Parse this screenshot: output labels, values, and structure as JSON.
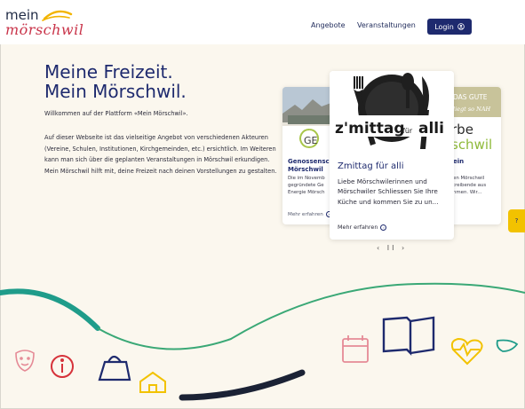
{
  "header": {
    "logo_top": "mein",
    "logo_name": "mörschwil",
    "nav": [
      "Angebote",
      "Veranstaltungen"
    ],
    "login_label": "Login",
    "login_icon": "user-circle-icon"
  },
  "hero": {
    "title_line1": "Meine Freizeit.",
    "title_line2": "Mein Mörschwil.",
    "intro": "Willkommen auf der Plattform «Mein Mörschwil».",
    "body": "Auf dieser Webseite ist das vielseitige Angebot von verschiedenen Akteuren (Vereine, Schulen, Institutionen, Kirchgemeinden, etc.) ersichtlich. Im Weiteren kann man sich über die geplanten Veranstaltungen in Mörschwil erkundigen. Mein Mörschwil hilft mit, deine Freizeit nach deinen Vorstellungen zu gestalten."
  },
  "cards": {
    "left": {
      "logo_text": "GE",
      "title": "Genossensc Mörschwil",
      "text": "Die im Novemb gegründete Ge Energie Mörsch",
      "more": "Mehr erfahren"
    },
    "center": {
      "image_text": "z'mittag",
      "image_small": "für",
      "image_text2": "alli",
      "title": "Zmittag für alli",
      "text": "Liebe Mörschwilerinnen und Mörschwiler Schliessen Sie Ihre Küche und kommen Sie zu un...",
      "more": "Mehr erfahren"
    },
    "right": {
      "banner_line1": "DAS GUTE",
      "banner_line2": "liegt so NAH",
      "big_text": "rbe",
      "big_text2": "schwil",
      "title": "ein",
      "text": "en Mörschwil treibende aus nmen. Wir...",
      "more": ""
    }
  },
  "pager": {
    "prev": "‹",
    "pause": "II",
    "next": "›"
  },
  "side_tab": "?",
  "colors": {
    "navy": "#1e2a6e",
    "brand_red": "#c9344a",
    "yellow": "#f2c200",
    "teal": "#1f9c8a",
    "background": "#fbf7ee"
  }
}
